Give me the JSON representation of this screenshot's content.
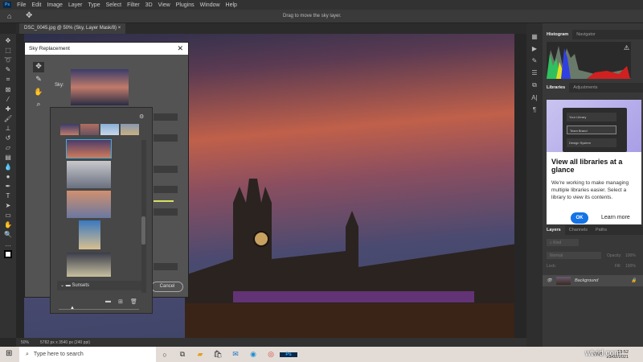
{
  "menubar": {
    "logo": "Ps",
    "items": [
      "File",
      "Edit",
      "Image",
      "Layer",
      "Type",
      "Select",
      "Filter",
      "3D",
      "View",
      "Plugins",
      "Window",
      "Help"
    ]
  },
  "options": {
    "hint": "Drag to move the sky layer."
  },
  "document": {
    "tab": "DSC_0045.jpg @ 50% (Sky, Layer Mask/8)",
    "close": "×"
  },
  "dialog": {
    "title": "Sky Replacement",
    "close": "✕",
    "sky_label": "Sky:",
    "folder": "Sunsets",
    "cancel": "Cancel"
  },
  "status": {
    "zoom": "50%",
    "info": "5782 px x 3540 px (240 ppi)"
  },
  "panels": {
    "top_tabs": [
      "Histogram",
      "Navigator"
    ],
    "mid_tabs": [
      "Libraries",
      "Adjustments"
    ],
    "library_card": {
      "mock_rows": [
        "Your Library",
        "Team Brand",
        "Design System"
      ],
      "heading": "View all libraries at a glance",
      "body": "We're working to make managing multiple libraries easier. Select a library to view its contents.",
      "ok": "OK",
      "learn_more": "Learn more"
    },
    "layer_tabs": [
      "Layers",
      "Channels",
      "Paths"
    ],
    "filter_placeholder": "Kind",
    "blend_mode": "Normal",
    "opacity_label": "Opacity:",
    "opacity": "100%",
    "lock_label": "Lock:",
    "fill_label": "Fill:",
    "fill": "100%",
    "layers": [
      {
        "name": "Background"
      }
    ]
  },
  "taskbar": {
    "search_placeholder": "Type here to search",
    "lang": "ENG",
    "time": "13:52",
    "date": "23/02/2021",
    "watermark": "wtvid.com"
  }
}
